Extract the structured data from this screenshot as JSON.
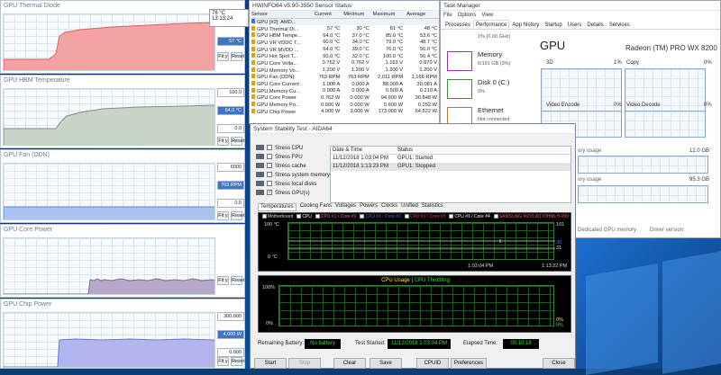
{
  "left_panels": {
    "gpu_thermal_diode": {
      "title": "GPU Thermal Diode",
      "tooltip_value": "76 °C",
      "tooltip_time": "13:13:24",
      "max_box": "",
      "current_box": "57 °C",
      "min_box": "",
      "fit_label": "Fit y",
      "reset_label": "Reset"
    },
    "gpu_hbm_temperature": {
      "title": "GPU HBM Temperature",
      "max_box": "100.0",
      "current_box": "64.0 °C",
      "min_box": "0.0",
      "fit_label": "Fit y",
      "reset_label": "Reset"
    },
    "gpu_fan": {
      "title": "GPU Fan (DDN)",
      "max_box": "6000",
      "current_box": "763 RPM",
      "min_box": "0.0",
      "fit_label": "Fit y",
      "reset_label": "Reset"
    },
    "gpu_core_power": {
      "title": "GPU Core Power",
      "max_box": "",
      "current_box": "",
      "min_box": "",
      "fit_label": "Fit y",
      "reset_label": "Reset"
    },
    "gpu_chip_power": {
      "title": "GPU Chip Power",
      "max_box": "300.000",
      "current_box": "4.000 W",
      "min_box": "0.000",
      "fit_label": "Fit y",
      "reset_label": "Reset"
    }
  },
  "hwinfo": {
    "title": "HWiNFO64 v5.90-3550 Sensor Status",
    "columns": [
      "Sensor",
      "Current",
      "Minimum",
      "Maximum",
      "Average"
    ],
    "rows": [
      {
        "sensor": "GPU [#2]: AMD...",
        "current": "",
        "minimum": "",
        "maximum": "",
        "average": ""
      },
      {
        "sensor": "GPU Thermal Di...",
        "current": "57 °C",
        "minimum": "30 °C",
        "maximum": "81 °C",
        "average": "48 °C"
      },
      {
        "sensor": "GPU HBM Tempe...",
        "current": "64.0 °C",
        "minimum": "37.0 °C",
        "maximum": "85.0 °C",
        "average": "53.6 °C"
      },
      {
        "sensor": "GPU VR VDDC T...",
        "current": "60.0 °C",
        "minimum": "34.0 °C",
        "maximum": "79.0 °C",
        "average": "48.7 °C"
      },
      {
        "sensor": "GPU VR MVDD ...",
        "current": "64.0 °C",
        "minimum": "39.0 °C",
        "maximum": "76.0 °C",
        "average": "56.0 °C"
      },
      {
        "sensor": "GPU Hot Spot T...",
        "current": "60.0 °C",
        "minimum": "32.0 °C",
        "maximum": "100.0 °C",
        "average": "56.4 °C"
      },
      {
        "sensor": "GPU Core Volta...",
        "current": "0.762 V",
        "minimum": "0.762 V",
        "maximum": "1.163 V",
        "average": "0.870 V"
      },
      {
        "sensor": "GPU Memory Vo...",
        "current": "1.200 V",
        "minimum": "1.200 V",
        "maximum": "1.200 V",
        "average": "1.200 V"
      },
      {
        "sensor": "GPU Fan (DDN)",
        "current": "763 RPM",
        "minimum": "763 RPM",
        "maximum": "2,011 RPM",
        "average": "1,166 RPM"
      },
      {
        "sensor": "GPU Core Current",
        "current": "1.000 A",
        "minimum": "0.000 A",
        "maximum": "88.000 A",
        "average": "30.081 A"
      },
      {
        "sensor": "GPU Memory Cu...",
        "current": "0.000 A",
        "minimum": "0.000 A",
        "maximum": "0.500 A",
        "average": "0.210 A"
      },
      {
        "sensor": "GPU Core Power",
        "current": "0.762 W",
        "minimum": "0.000 W",
        "maximum": "94.600 W",
        "average": "30.848 W"
      },
      {
        "sensor": "GPU Memory Po...",
        "current": "0.600 W",
        "minimum": "0.000 W",
        "maximum": "0.600 W",
        "average": "0.252 W"
      },
      {
        "sensor": "GPU Chip Power",
        "current": "4.000 W",
        "minimum": "3.000 W",
        "maximum": "173.000 W",
        "average": "64.522 W"
      }
    ]
  },
  "taskmgr": {
    "title": "Task Manager",
    "menu": [
      "File",
      "Options",
      "View"
    ],
    "tabs": [
      "Processes",
      "Performance",
      "App history",
      "Startup",
      "Users",
      "Details",
      "Services"
    ],
    "active_tab": "Performance",
    "side_items": [
      {
        "name": "",
        "detail": "1% (0.00 GHz)"
      },
      {
        "name": "Memory",
        "detail": "6/191 GB (3%)"
      },
      {
        "name": "Disk 0 (C:)",
        "detail": "0%"
      },
      {
        "name": "Ethernet",
        "detail": "Not connected"
      }
    ],
    "heading": "GPU",
    "gpu_name": "Radeon (TM) PRO WX 8200",
    "graphs": [
      {
        "label": "3D",
        "pct": "1%"
      },
      {
        "label": "Copy",
        "pct": "0%"
      },
      {
        "label": "Video Encode",
        "pct": "0%"
      },
      {
        "label": "Video Decode",
        "pct": "0%"
      }
    ],
    "partial_labels": [
      "ory usage",
      "ory usage",
      "Dedicated GPU memory",
      "Driver version:"
    ],
    "mem_values": [
      "12.0 GB",
      "95.3 GB"
    ]
  },
  "aida": {
    "title": "System Stability Test - AIDA64",
    "stress_items": [
      {
        "label": "Stress CPU",
        "checked": ""
      },
      {
        "label": "Stress FPU",
        "checked": ""
      },
      {
        "label": "Stress cache",
        "checked": ""
      },
      {
        "label": "Stress system memory",
        "checked": ""
      },
      {
        "label": "Stress local disks",
        "checked": ""
      },
      {
        "label": "Stress GPU(s)",
        "checked": "✓"
      }
    ],
    "log_headers": [
      "Date & Time",
      "Status"
    ],
    "log_rows": [
      {
        "time": "11/12/2018 1:03:04 PM",
        "status": "GPU1: Started"
      },
      {
        "time": "11/12/2018 1:13:23 PM",
        "status": "GPU1: Stopped"
      }
    ],
    "tabs": [
      "Temperatures",
      "Cooling Fans",
      "Voltages",
      "Powers",
      "Clocks",
      "Unified",
      "Statistics"
    ],
    "legend": [
      "Motherboard",
      "CPU",
      "CPU #1 / Core #1",
      "CPU #1 / Core #2",
      "CPU #1 / Core #3",
      "CPU #1 / Core #4",
      "SAMSUNG MZVLW1T0HMLH-000"
    ],
    "temp_chart": {
      "ymax": "100 °C",
      "ymin": "0 °C",
      "t_start": "1:03:04 PM",
      "t_end": "1:13:22 PM",
      "val_hi": "101",
      "val_lo": "30",
      "val_lo2": "31"
    },
    "usage_chart": {
      "title_usage": "CPU Usage",
      "separator": "|",
      "title_throttle": "CPU Throttling",
      "ymax": "100%",
      "ymin": "0%",
      "val_lo": "0%",
      "val_lo2": "0%"
    },
    "remaining_battery_label": "Remaining Battery:",
    "remaining_battery_value": "No battery",
    "test_started_label": "Test Started:",
    "test_started_value": "11/12/2018 1:03:04 PM",
    "elapsed_label": "Elapsed Time:",
    "elapsed_value": "00:10:18",
    "buttons": {
      "start": "Start",
      "stop": "Stop",
      "clear": "Clear",
      "save": "Save",
      "cpuid": "CPUID",
      "preferences": "Preferences",
      "close": "Close"
    }
  }
}
